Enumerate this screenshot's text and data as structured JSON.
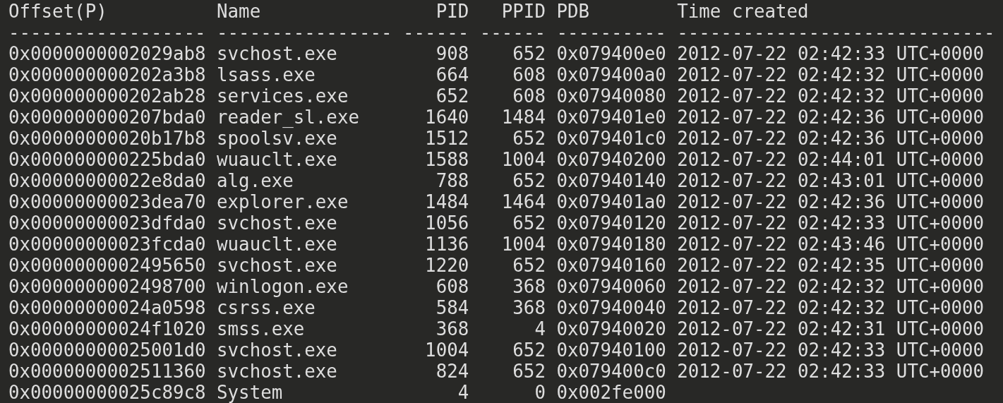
{
  "columns": [
    {
      "label": "Offset(P)",
      "underline": "------------------"
    },
    {
      "label": "Name",
      "underline": "----------------"
    },
    {
      "label": "PID",
      "underline": "------"
    },
    {
      "label": "PPID",
      "underline": "------"
    },
    {
      "label": "PDB",
      "underline": "----------"
    },
    {
      "label": "Time created",
      "underline": "-----------------------------"
    }
  ],
  "rows": [
    {
      "offset": "0x0000000002029ab8",
      "name": "svchost.exe",
      "pid": "908",
      "ppid": "652",
      "pdb": "0x079400e0",
      "time": "2012-07-22 02:42:33 UTC+0000"
    },
    {
      "offset": "0x000000000202a3b8",
      "name": "lsass.exe",
      "pid": "664",
      "ppid": "608",
      "pdb": "0x079400a0",
      "time": "2012-07-22 02:42:32 UTC+0000"
    },
    {
      "offset": "0x000000000202ab28",
      "name": "services.exe",
      "pid": "652",
      "ppid": "608",
      "pdb": "0x07940080",
      "time": "2012-07-22 02:42:32 UTC+0000"
    },
    {
      "offset": "0x000000000207bda0",
      "name": "reader_sl.exe",
      "pid": "1640",
      "ppid": "1484",
      "pdb": "0x079401e0",
      "time": "2012-07-22 02:42:36 UTC+0000"
    },
    {
      "offset": "0x00000000020b17b8",
      "name": "spoolsv.exe",
      "pid": "1512",
      "ppid": "652",
      "pdb": "0x079401c0",
      "time": "2012-07-22 02:42:36 UTC+0000"
    },
    {
      "offset": "0x000000000225bda0",
      "name": "wuauclt.exe",
      "pid": "1588",
      "ppid": "1004",
      "pdb": "0x07940200",
      "time": "2012-07-22 02:44:01 UTC+0000"
    },
    {
      "offset": "0x00000000022e8da0",
      "name": "alg.exe",
      "pid": "788",
      "ppid": "652",
      "pdb": "0x07940140",
      "time": "2012-07-22 02:43:01 UTC+0000"
    },
    {
      "offset": "0x00000000023dea70",
      "name": "explorer.exe",
      "pid": "1484",
      "ppid": "1464",
      "pdb": "0x079401a0",
      "time": "2012-07-22 02:42:36 UTC+0000"
    },
    {
      "offset": "0x00000000023dfda0",
      "name": "svchost.exe",
      "pid": "1056",
      "ppid": "652",
      "pdb": "0x07940120",
      "time": "2012-07-22 02:42:33 UTC+0000"
    },
    {
      "offset": "0x00000000023fcda0",
      "name": "wuauclt.exe",
      "pid": "1136",
      "ppid": "1004",
      "pdb": "0x07940180",
      "time": "2012-07-22 02:43:46 UTC+0000"
    },
    {
      "offset": "0x0000000002495650",
      "name": "svchost.exe",
      "pid": "1220",
      "ppid": "652",
      "pdb": "0x07940160",
      "time": "2012-07-22 02:42:35 UTC+0000"
    },
    {
      "offset": "0x0000000002498700",
      "name": "winlogon.exe",
      "pid": "608",
      "ppid": "368",
      "pdb": "0x07940060",
      "time": "2012-07-22 02:42:32 UTC+0000"
    },
    {
      "offset": "0x00000000024a0598",
      "name": "csrss.exe",
      "pid": "584",
      "ppid": "368",
      "pdb": "0x07940040",
      "time": "2012-07-22 02:42:32 UTC+0000"
    },
    {
      "offset": "0x00000000024f1020",
      "name": "smss.exe",
      "pid": "368",
      "ppid": "4",
      "pdb": "0x07940020",
      "time": "2012-07-22 02:42:31 UTC+0000"
    },
    {
      "offset": "0x00000000025001d0",
      "name": "svchost.exe",
      "pid": "1004",
      "ppid": "652",
      "pdb": "0x07940100",
      "time": "2012-07-22 02:42:33 UTC+0000"
    },
    {
      "offset": "0x0000000002511360",
      "name": "svchost.exe",
      "pid": "824",
      "ppid": "652",
      "pdb": "0x079400c0",
      "time": "2012-07-22 02:42:33 UTC+0000"
    },
    {
      "offset": "0x00000000025c89c8",
      "name": "System",
      "pid": "4",
      "ppid": "0",
      "pdb": "0x002fe000"
    }
  ]
}
